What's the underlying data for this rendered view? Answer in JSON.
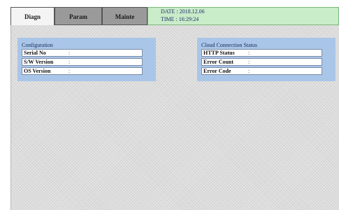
{
  "tabs": [
    {
      "label": "Diagn",
      "active": true
    },
    {
      "label": "Param",
      "active": false
    },
    {
      "label": "Mainte",
      "active": false
    }
  ],
  "status": {
    "date": "DATE : 2018.12.06",
    "time": "TIME : 16:29:24"
  },
  "configuration": {
    "title": "Configuration",
    "rows": [
      {
        "label": "Serial No",
        "sep": ":",
        "value": ""
      },
      {
        "label": "S/W Version",
        "sep": ":",
        "value": ""
      },
      {
        "label": "OS Version",
        "sep": ":",
        "value": ""
      }
    ]
  },
  "cloud": {
    "title": "Cloud Connection Status",
    "rows": [
      {
        "label": "HTTP Status",
        "sep": ":",
        "value": ""
      },
      {
        "label": "Error Count",
        "sep": ":",
        "value": ""
      },
      {
        "label": "Error Code",
        "sep": ":",
        "value": ""
      }
    ]
  },
  "colors": {
    "panel": "#a9c6e8",
    "status_bar": "#c9ecc9",
    "tab_inactive": "#9a9a9a"
  }
}
